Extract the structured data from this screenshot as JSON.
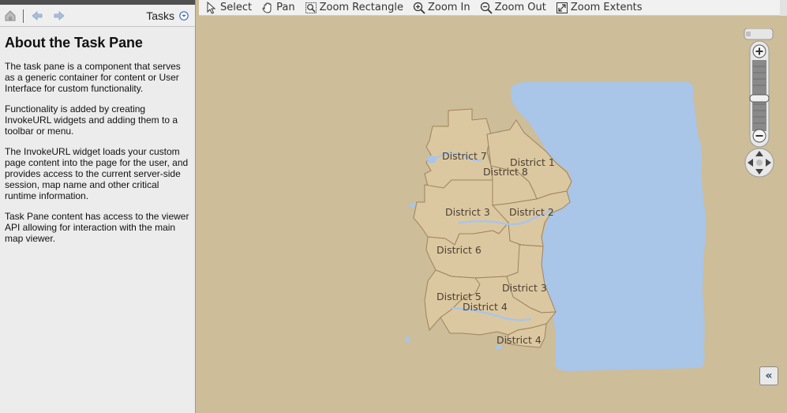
{
  "task_pane": {
    "menu_label": "Tasks",
    "title": "About the Task Pane",
    "paragraphs": [
      "The task pane is a component that serves as a generic container for content or User Interface for custom functionality.",
      "Functionality is added by creating InvokeURL widgets and adding them to a toolbar or menu.",
      "The InvokeURL widget loads your custom page content into the page for the user, and provides access to the current server-side session, map name and other critical runtime information.",
      "Task Pane content has access to the viewer API allowing for interaction with the main map viewer."
    ],
    "icons": {
      "home": "home-icon",
      "back": "back-arrow-icon",
      "forward": "forward-arrow-icon",
      "menu": "dropdown-circle-icon"
    }
  },
  "map_toolbar": {
    "items": [
      {
        "label": "Select",
        "icon": "select-cursor-icon"
      },
      {
        "label": "Pan",
        "icon": "pan-hand-icon"
      },
      {
        "label": "Zoom Rectangle",
        "icon": "zoom-rectangle-icon"
      },
      {
        "label": "Zoom In",
        "icon": "zoom-in-icon"
      },
      {
        "label": "Zoom Out",
        "icon": "zoom-out-icon"
      },
      {
        "label": "Zoom Extents",
        "icon": "zoom-extents-icon"
      }
    ]
  },
  "map": {
    "district_labels": [
      "District 7",
      "District 1",
      "District 8",
      "District 3",
      "District 2",
      "District 6",
      "District 3",
      "District 5",
      "District 4",
      "District 4"
    ],
    "colors": {
      "background": "#cdbd98",
      "water": "#a9c5e8",
      "district_fill": "#dcc8a0",
      "district_border": "#9c8460",
      "label": "#4a3f33"
    }
  },
  "navigator": {
    "icons": [
      "zoom-plus-icon",
      "zoom-slider-handle-icon",
      "zoom-minus-icon",
      "pan-arrows-icon"
    ]
  },
  "collapse_button": {
    "label": "«"
  }
}
